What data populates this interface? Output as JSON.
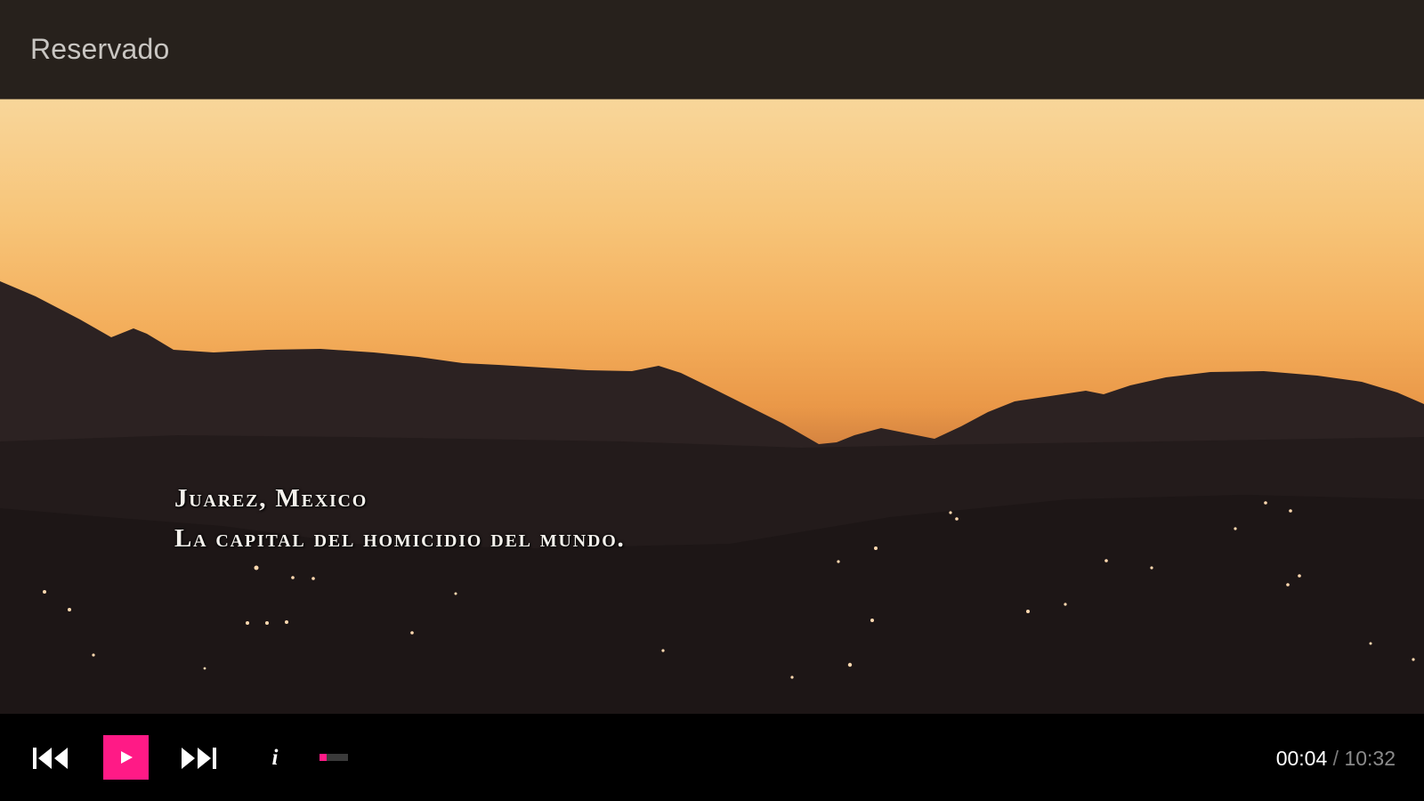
{
  "app": {
    "title": "Reservado"
  },
  "video": {
    "subtitle_line1": "Juarez, Mexico",
    "subtitle_line2": "La capital del homicidio del mundo."
  },
  "player": {
    "current_time": "00:04",
    "separator": " / ",
    "total_time": "10:32",
    "progress_fraction": 0.0063,
    "state": "paused",
    "info_label": "i"
  },
  "icons": {
    "previous": "skip-previous-icon",
    "play": "play-icon",
    "next": "skip-next-icon",
    "info": "info-icon"
  },
  "colors": {
    "accent": "#ff1a86",
    "topbar_bg": "#27211c",
    "controls_bg": "#000000",
    "title_text": "#c9c6c2",
    "time_current": "#ffffff",
    "time_total": "#8a8a8a"
  }
}
